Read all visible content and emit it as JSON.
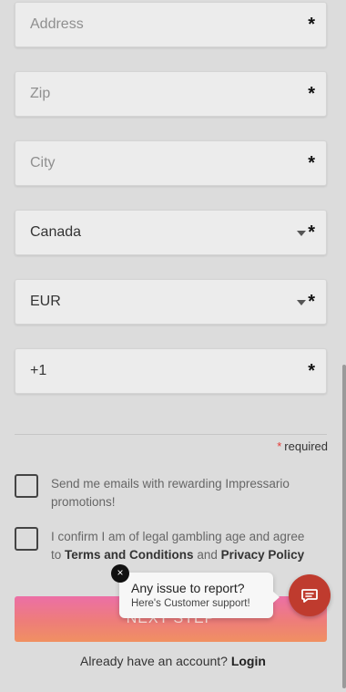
{
  "form": {
    "address": {
      "placeholder": "Address",
      "required_mark": "*"
    },
    "zip": {
      "placeholder": "Zip",
      "required_mark": "*"
    },
    "city": {
      "placeholder": "City",
      "required_mark": "*"
    },
    "country": {
      "value": "Canada",
      "required_mark": "*"
    },
    "currency": {
      "value": "EUR",
      "required_mark": "*"
    },
    "phone": {
      "value": "+1",
      "required_mark": "*"
    },
    "required_note": {
      "star": "*",
      "label": "required"
    },
    "emails_opt_in": {
      "label": "Send me emails with rewarding Impressario promotions!"
    },
    "age_confirm": {
      "prefix": "I confirm I am of legal gambling age and agree to",
      "terms": "Terms and Conditions",
      "and": "and",
      "privacy": "Privacy Policy"
    },
    "next_button": "Next step",
    "login_prompt": "Already have an account?",
    "login_link": "Login"
  },
  "support": {
    "title": "Any issue to report?",
    "subtitle": "Here's Customer support!",
    "close_icon": "×"
  },
  "colors": {
    "accent_start": "#ec6fa6",
    "accent_end": "#f09062",
    "chat_button": "#bf3b2e",
    "required_star": "#e53935"
  },
  "icons": {
    "chat": "chat-icon",
    "caret": "chevron-down-icon"
  }
}
